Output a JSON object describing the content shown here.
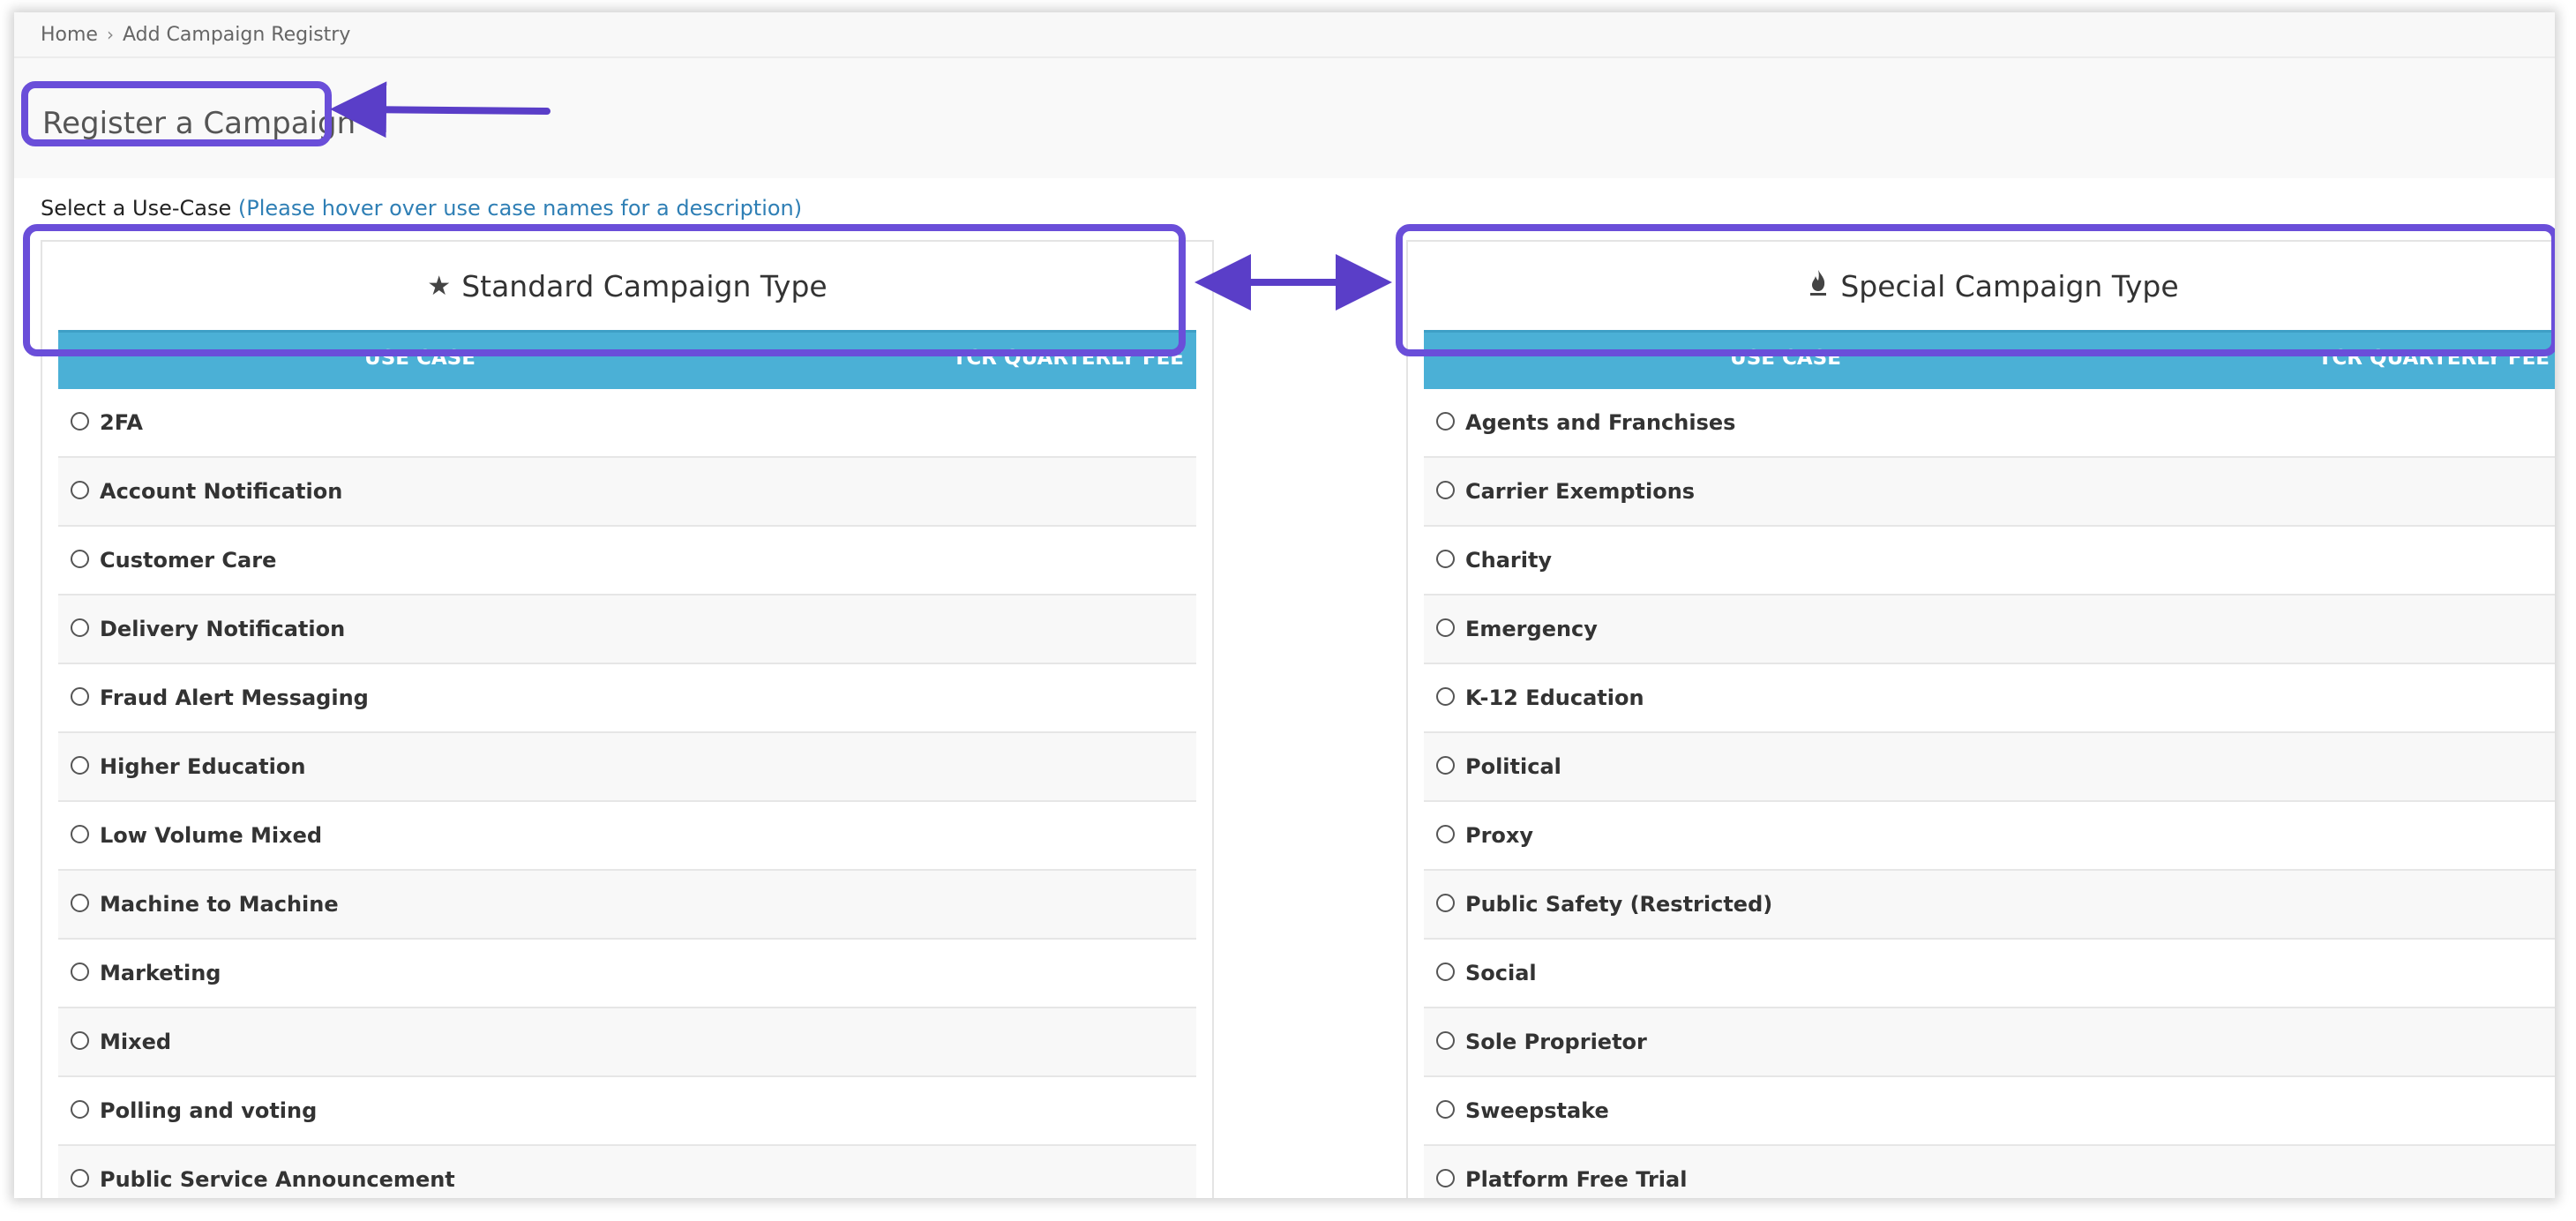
{
  "breadcrumb": {
    "home": "Home",
    "separator": "›",
    "current": "Add Campaign Registry"
  },
  "page": {
    "title": "Register a Campaign"
  },
  "instruction": {
    "text": "Select a Use-Case",
    "hint": "(Please hover over use case names for a description)"
  },
  "standard_panel": {
    "icon": "star-icon",
    "title": "Standard Campaign Type",
    "col_use_case": "USE CASE",
    "col_fee": "TCR QUARTERLY FEE",
    "items": [
      "2FA",
      "Account Notification",
      "Customer Care",
      "Delivery Notification",
      "Fraud Alert Messaging",
      "Higher Education",
      "Low Volume Mixed",
      "Machine to Machine",
      "Marketing",
      "Mixed",
      "Polling and voting",
      "Public Service Announcement"
    ]
  },
  "special_panel": {
    "icon": "flame-icon",
    "title": "Special Campaign Type",
    "col_use_case": "USE CASE",
    "col_fee": "TCR QUARTERLY FEE",
    "items": [
      "Agents and Franchises",
      "Carrier Exemptions",
      "Charity",
      "Emergency",
      "K-12 Education",
      "Political",
      "Proxy",
      "Public Safety (Restricted)",
      "Social",
      "Sole Proprietor",
      "Sweepstake",
      "Platform Free Trial"
    ]
  },
  "annotation_color": "#6a4ed9"
}
